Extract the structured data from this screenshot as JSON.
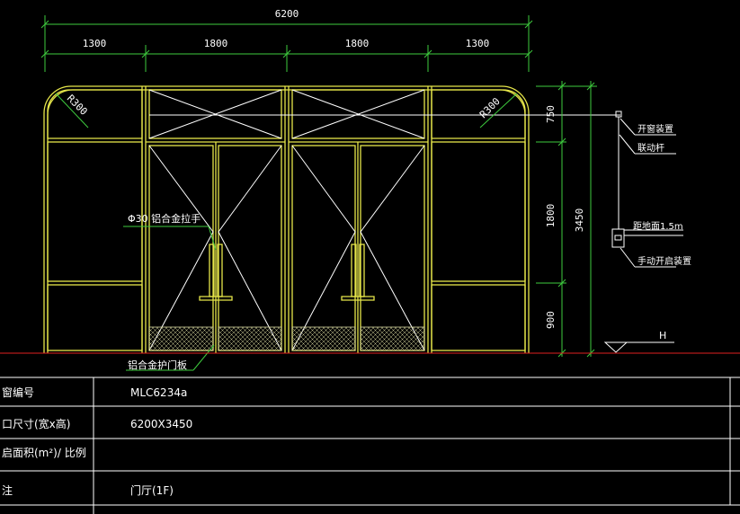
{
  "drawing": {
    "dimensions": {
      "overall_width": "6200",
      "segments": [
        "1300",
        "1800",
        "1800",
        "1300"
      ],
      "overall_height": "3450",
      "vertical_segments": [
        "750",
        "1800",
        "900"
      ]
    },
    "radius_labels": [
      "R300",
      "R300"
    ],
    "handle_label": "Φ30 铝合金拉手",
    "kick_plate_label": "铝合金护门板",
    "device_labels": [
      "开窗装置",
      "联动杆",
      "距地面1.5m",
      "手动开启装置"
    ],
    "ground_label": "H"
  },
  "table": {
    "rows": [
      {
        "label": "窗编号",
        "value": "MLC6234a"
      },
      {
        "label": "口尺寸(宽x高)",
        "value": "6200X3450"
      },
      {
        "label": "启面积(m²)/ 比例",
        "value": ""
      },
      {
        "label": "注",
        "value": "门厅(1F)"
      }
    ]
  },
  "colors": {
    "background": "#000000",
    "frame": "#e6e64a",
    "dimension": "#3ecb3e",
    "ground": "#e02020"
  }
}
